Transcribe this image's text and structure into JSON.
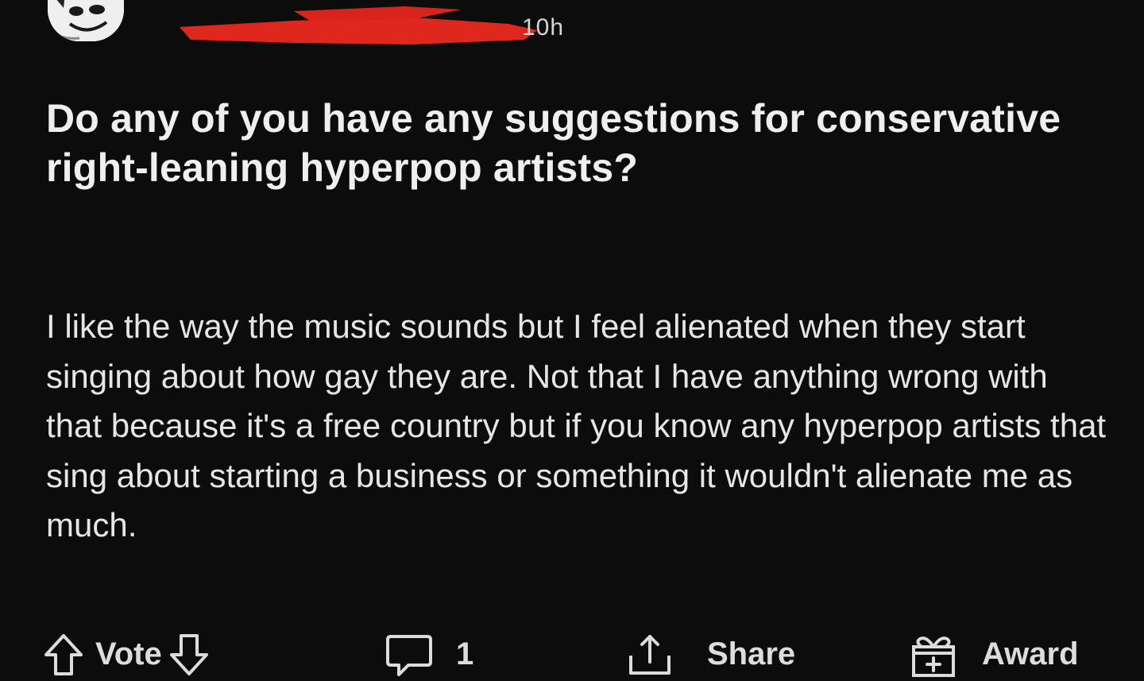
{
  "post": {
    "timestamp": "10h",
    "title": "Do any of you have any suggestions for conservative right-leaning hyperpop artists?",
    "body": "I like the way the music sounds but I feel alienated when they start singing about how gay they are. Not that I have anything wrong with that because it's a free country but if you know any hyperpop artists that sing about starting a business or something it wouldn't alienate me as much."
  },
  "actions": {
    "vote_label": "Vote",
    "comment_count": "1",
    "share_label": "Share",
    "award_label": "Award"
  },
  "colors": {
    "background": "#0c0c0d",
    "text": "#e9e9ea",
    "redaction": "#e0271d"
  },
  "icons": {
    "upvote": "arrow-up-outline-icon",
    "downvote": "arrow-down-outline-icon",
    "comment": "speech-bubble-icon",
    "share": "share-upload-icon",
    "award": "gift-box-icon"
  }
}
